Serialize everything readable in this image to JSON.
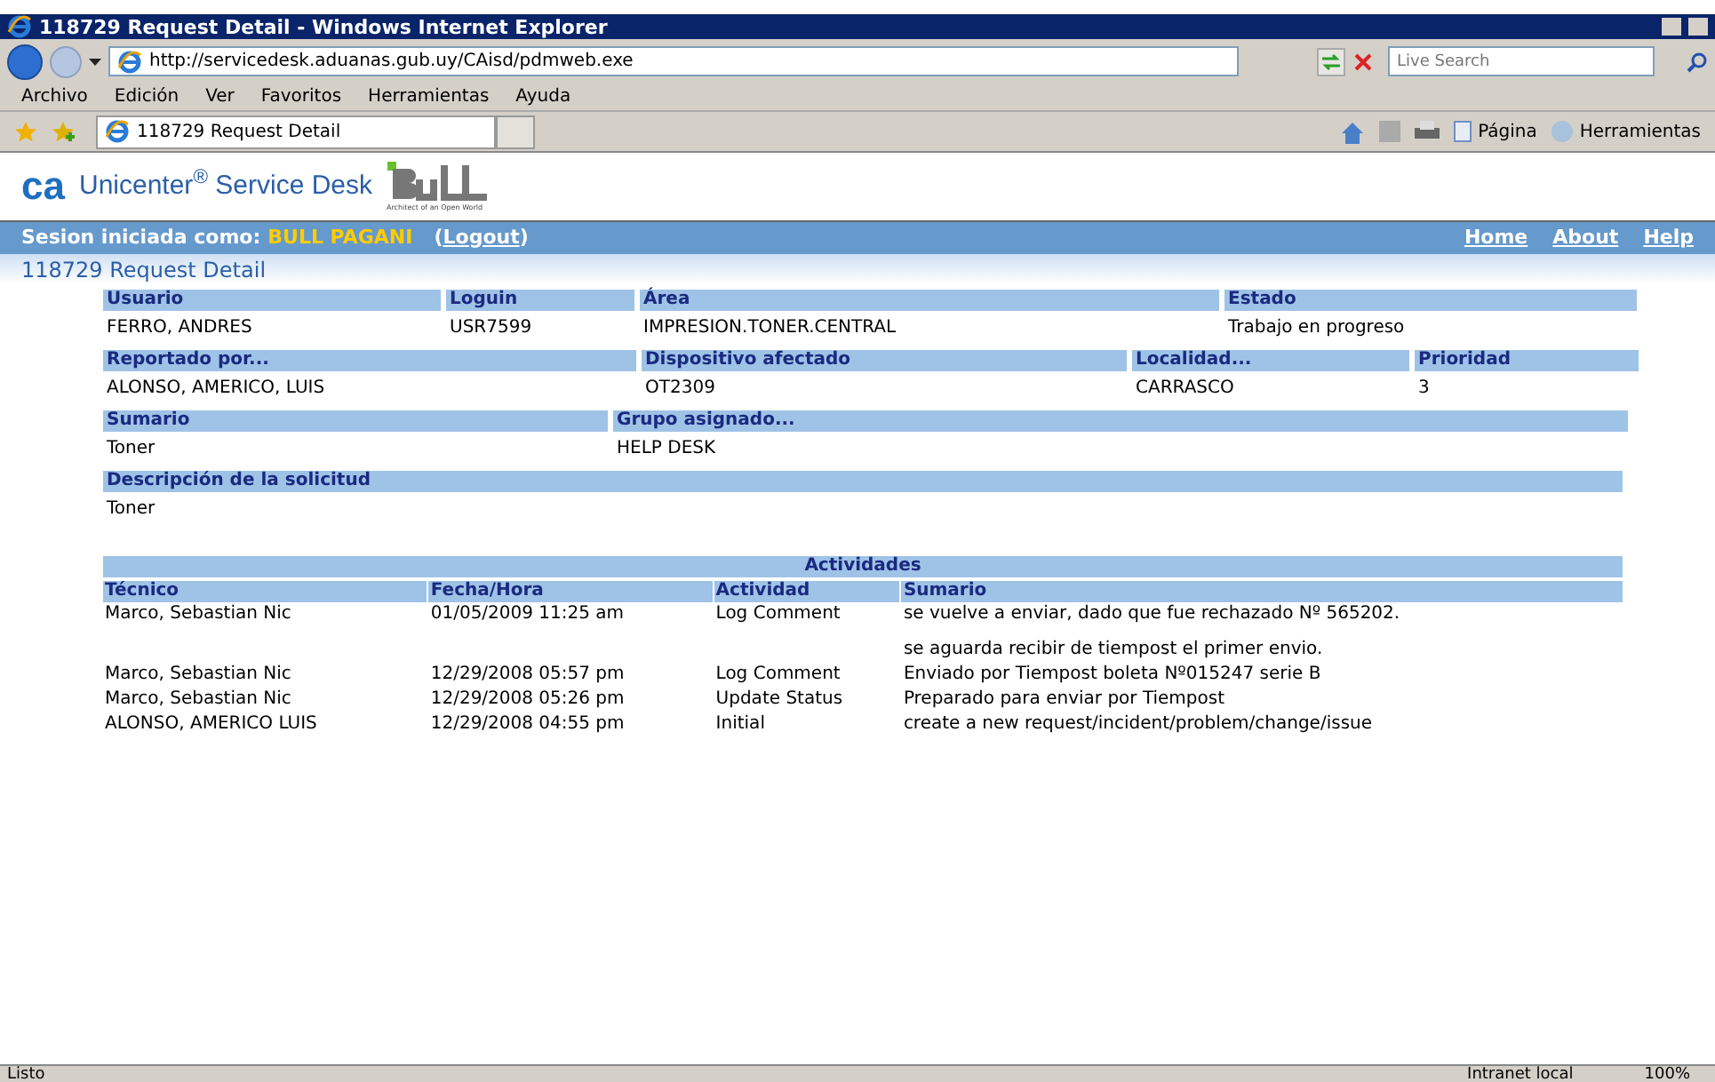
{
  "window": {
    "title": "118729 Request Detail - Windows Internet Explorer"
  },
  "address_bar": {
    "url": "http://servicedesk.aduanas.gub.uy/CAisd/pdmweb.exe",
    "search_placeholder": "Live Search"
  },
  "menu": [
    "Archivo",
    "Edición",
    "Ver",
    "Favoritos",
    "Herramientas",
    "Ayuda"
  ],
  "tab": {
    "label": "118729 Request Detail"
  },
  "command_bar": [
    "Página",
    "Herramientas"
  ],
  "header": {
    "logo": "ca",
    "product": "Unicenter",
    "reg": "®",
    "product_rest": " Service Desk",
    "partner_tagline": "Architect of an Open World"
  },
  "session": {
    "label": "Sesion iniciada como:",
    "user": "BULL PAGANI",
    "logout_open": "(",
    "logout": "Logout",
    "logout_close": ")",
    "links": [
      "Home",
      "About",
      "Help"
    ]
  },
  "page_title": "118729 Request Detail",
  "field_rows": [
    [
      {
        "label": "Usuario",
        "value": "FERRO, ANDRES"
      },
      {
        "label": "Loguin",
        "value": "USR7599"
      },
      {
        "label": "Área",
        "value": "IMPRESION.TONER.CENTRAL"
      },
      {
        "label": "Estado",
        "value": "Trabajo en progreso"
      }
    ],
    [
      {
        "label": "Reportado por...",
        "value": "ALONSO, AMERICO, LUIS"
      },
      {
        "label": "Dispositivo afectado",
        "value": "OT2309"
      },
      {
        "label": "Localidad...",
        "value": "CARRASCO"
      },
      {
        "label": "Prioridad",
        "value": "3"
      }
    ],
    [
      {
        "label": "Sumario",
        "value": "Toner"
      },
      {
        "label": "Grupo asignado...",
        "value": "HELP DESK"
      }
    ],
    [
      {
        "label": "Descripción de la solicitud",
        "value": "Toner"
      }
    ]
  ],
  "activities": {
    "title": "Actividades",
    "columns": [
      "Técnico",
      "Fecha/Hora",
      "Actividad",
      "Sumario"
    ],
    "rows": [
      {
        "tecnico": "Marco, Sebastian Nic",
        "fecha": "01/05/2009 11:25 am",
        "actividad": "Log Comment",
        "sumario": [
          "se vuelve a enviar, dado que fue rechazado Nº 565202.",
          "se aguarda recibir de tiempost el primer envio."
        ]
      },
      {
        "tecnico": "Marco, Sebastian Nic",
        "fecha": "12/29/2008 05:57 pm",
        "actividad": "Log Comment",
        "sumario": [
          "Enviado por Tiempost boleta Nº015247 serie B"
        ]
      },
      {
        "tecnico": "Marco, Sebastian Nic",
        "fecha": "12/29/2008 05:26 pm",
        "actividad": "Update Status",
        "sumario": [
          "Preparado para enviar por Tiempost"
        ]
      },
      {
        "tecnico": "ALONSO, AMERICO LUIS",
        "fecha": "12/29/2008 04:55 pm",
        "actividad": "Initial",
        "sumario": [
          "create a new request/incident/problem/change/issue"
        ]
      }
    ]
  },
  "status_bar": {
    "text": "Listo",
    "zone": "Intranet local",
    "zoom": "100%"
  }
}
